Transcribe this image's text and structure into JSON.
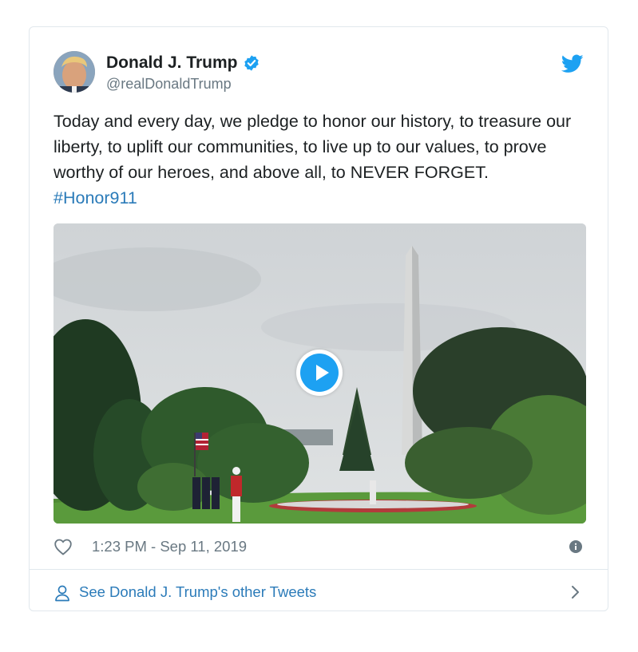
{
  "tweet": {
    "author": {
      "display_name": "Donald J. Trump",
      "handle": "@realDonaldTrump",
      "verified": true
    },
    "text_main": "Today and every day, we pledge to honor our history, to treasure our liberty, to uplift our communities, to live up to our values, to prove worthy of our heroes, and above all, to NEVER FORGET.",
    "hashtag": "#Honor911",
    "timestamp": "1:23 PM - Sep 11, 2019",
    "footer_link": "See Donald J. Trump's other Tweets"
  },
  "icons": {
    "bird": "twitter-bird-icon",
    "verified": "verified-badge-icon",
    "heart": "heart-icon",
    "info": "info-icon",
    "person": "person-icon",
    "chevron": "chevron-right-icon",
    "play": "play-icon"
  },
  "colors": {
    "brand_blue": "#1da1f2",
    "link_blue": "#2b7bb9",
    "text_primary": "#1c2022",
    "text_secondary": "#697882",
    "border": "#e1e8ed"
  }
}
